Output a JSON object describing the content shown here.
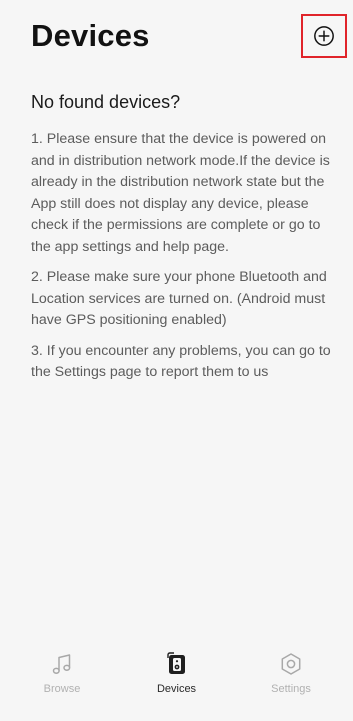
{
  "header": {
    "title": "Devices"
  },
  "empty_state": {
    "title": "No found devices?",
    "tips": [
      "1. Please ensure that the device is powered on and in distribution network mode.If the device is already in the distribution network state but the App still does not display any device, please check if the permissions are complete or go to the app settings and help page.",
      "2. Please make sure your phone Bluetooth and Location services are turned on. (Android must have GPS positioning enabled)",
      "3. If you encounter any problems, you can go to the Settings page to report them to us"
    ]
  },
  "bottom_nav": {
    "items": [
      {
        "label": "Browse",
        "icon": "music-note-icon",
        "active": false
      },
      {
        "label": "Devices",
        "icon": "speaker-icon",
        "active": true
      },
      {
        "label": "Settings",
        "icon": "gear-icon",
        "active": false
      }
    ]
  },
  "colors": {
    "background": "#f6f6f6",
    "highlight_border": "#e0242a",
    "text_primary": "#121212",
    "text_secondary": "#5c5c5c",
    "nav_inactive": "#b1b1b1",
    "nav_active": "#2a2a2a"
  }
}
